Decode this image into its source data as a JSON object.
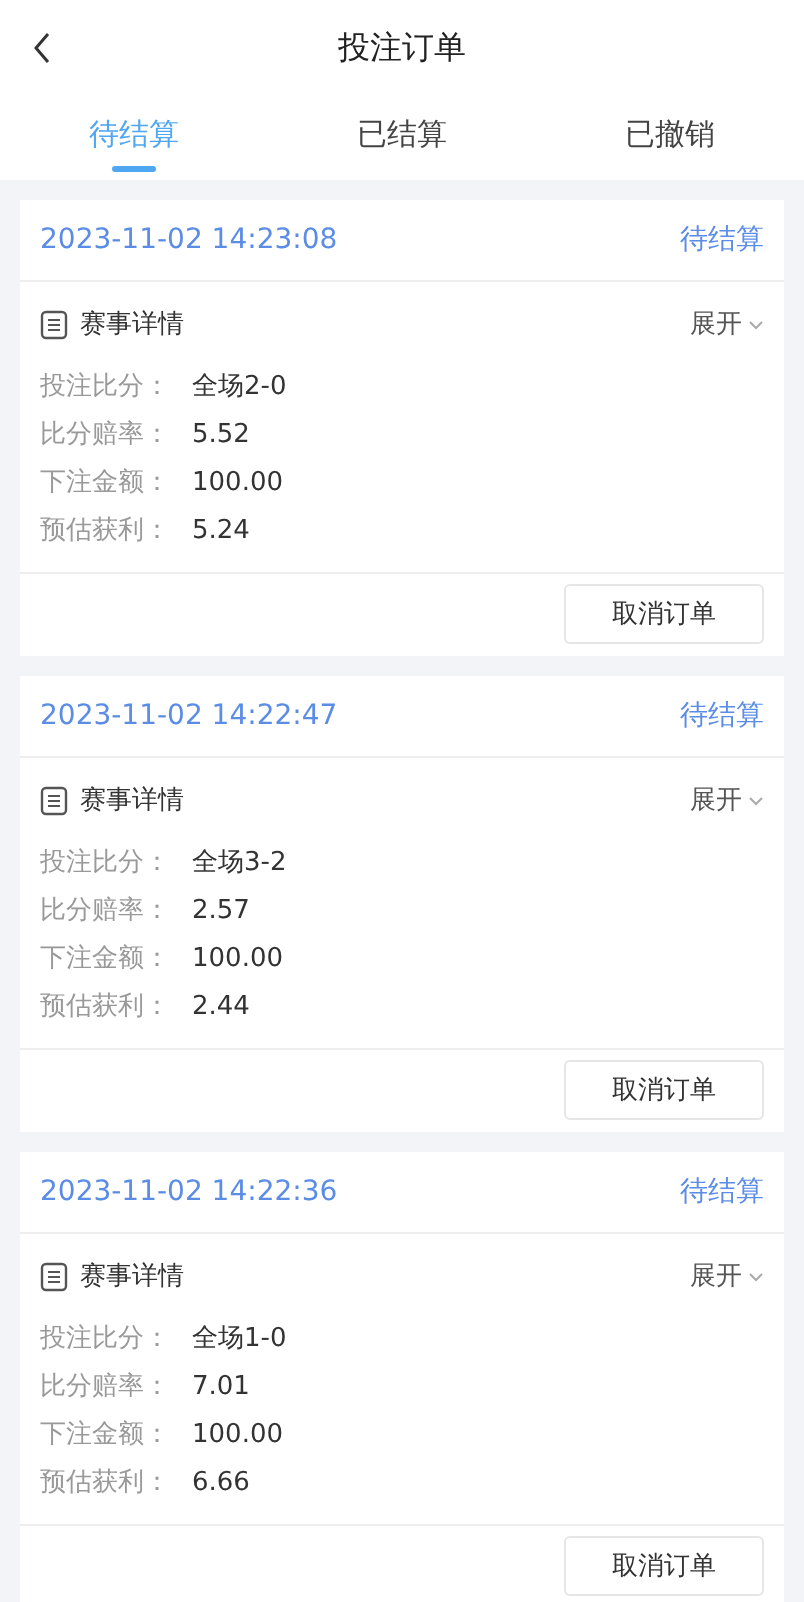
{
  "header": {
    "title": "投注订单"
  },
  "tabs": [
    {
      "label": "待结算",
      "selected": true
    },
    {
      "label": "已结算",
      "selected": false
    },
    {
      "label": "已撤销",
      "selected": false
    }
  ],
  "orders": [
    {
      "time": "2023-11-02 14:23:08",
      "status": "待结算",
      "detail_title": "赛事详情",
      "toggle": "展开",
      "fields": [
        {
          "label": "投注比分：",
          "value": "全场2-0"
        },
        {
          "label": "比分赔率：",
          "value": "5.52"
        },
        {
          "label": "下注金额：",
          "value": "100.00"
        },
        {
          "label": "预估获利：",
          "value": "5.24"
        }
      ],
      "button": "取消订单"
    },
    {
      "time": "2023-11-02 14:22:47",
      "status": "待结算",
      "detail_title": "赛事详情",
      "toggle": "展开",
      "fields": [
        {
          "label": "投注比分：",
          "value": "全场3-2"
        },
        {
          "label": "比分赔率：",
          "value": "2.57"
        },
        {
          "label": "下注金额：",
          "value": "100.00"
        },
        {
          "label": "预估获利：",
          "value": "2.44"
        }
      ],
      "button": "取消订单"
    },
    {
      "time": "2023-11-02 14:22:36",
      "status": "待结算",
      "detail_title": "赛事详情",
      "toggle": "展开",
      "fields": [
        {
          "label": "投注比分：",
          "value": "全场1-0"
        },
        {
          "label": "比分赔率：",
          "value": "7.01"
        },
        {
          "label": "下注金额：",
          "value": "100.00"
        },
        {
          "label": "预估获利：",
          "value": "6.66"
        }
      ],
      "button": "取消订单"
    }
  ]
}
